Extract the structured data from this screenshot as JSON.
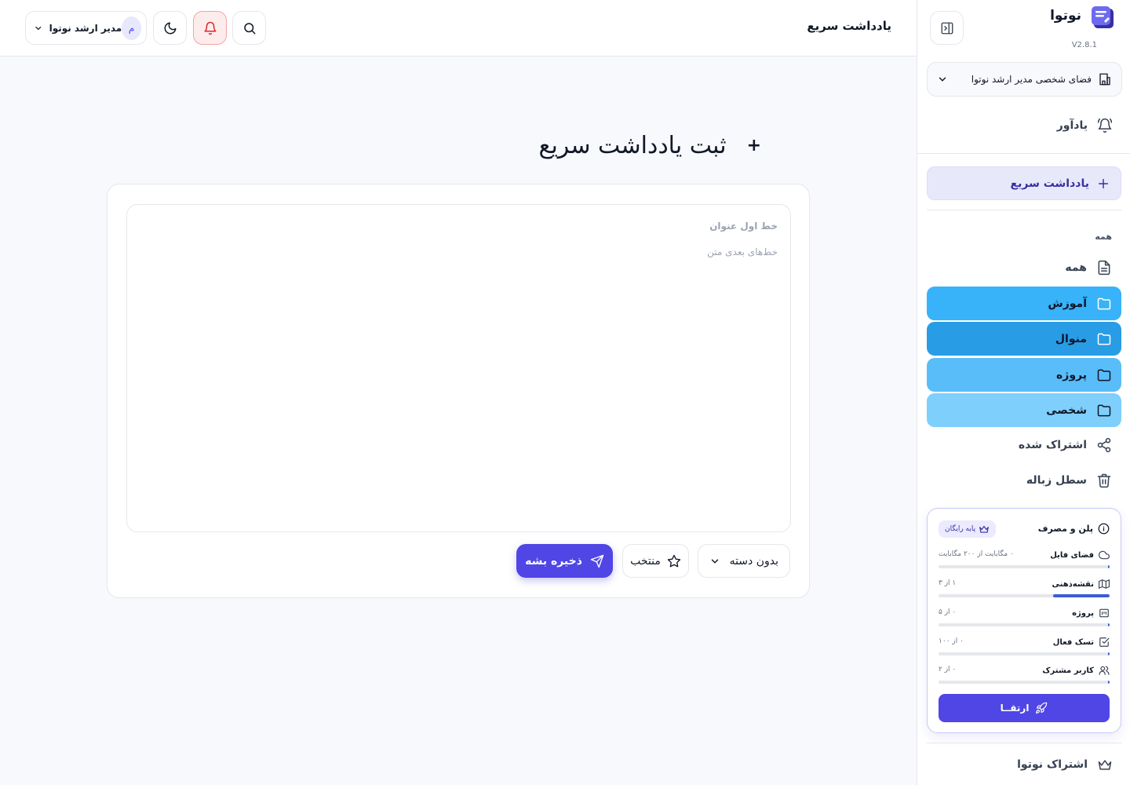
{
  "app": {
    "name": "نوتوا",
    "version": "V2.8.1"
  },
  "header": {
    "title": "یادداشت سریع",
    "user_name": "مدیر ارشد نوتوا",
    "avatar_initial": "م"
  },
  "sidebar": {
    "workspace": "فضای شخصی مدیر ارشد نوتوا",
    "reminder": "یادآور",
    "quick_note": "یادداشت سریع",
    "section_title": "همه",
    "nav_all": "همه",
    "folders": [
      {
        "label": "آموزش",
        "color": "#38b2f9"
      },
      {
        "label": "منوال",
        "color": "#299ce6"
      },
      {
        "label": "پروژه",
        "color": "#59bdf9"
      },
      {
        "label": "شخصی",
        "color": "#7ecffc"
      }
    ],
    "shared": "اشتراک شده",
    "trash": "سطل زباله",
    "subscription": "اشتراک نوتوا"
  },
  "plan": {
    "title": "پلن و مصرف",
    "badge": "پایه رایگان",
    "usages": [
      {
        "label": "فضای فایل",
        "value": "۰ مگابایت از ۲۰۰ مگابایت",
        "fraction": 0.0,
        "icon": "cloud-icon"
      },
      {
        "label": "نقشه‌ذهنی",
        "value": "۱ از ۳",
        "fraction": 0.33,
        "icon": "map-icon"
      },
      {
        "label": "پروژه",
        "value": "۰ از ۵",
        "fraction": 0.0,
        "icon": "project-icon"
      },
      {
        "label": "تسک فعال",
        "value": "۰ از ۱۰۰",
        "fraction": 0.0,
        "icon": "checkbox-icon"
      },
      {
        "label": "کاربر مشترک",
        "value": "۰ از ۲",
        "fraction": 0.0,
        "icon": "users-icon"
      }
    ],
    "upgrade": "ارتقــا"
  },
  "main": {
    "heading": "ثبت یادداشت سریع",
    "title_placeholder": "خط اول عنوان",
    "body_placeholder": "خط‌های بعدی متن",
    "category": "بدون دسته",
    "favorite": "منتخب",
    "save": "ذخیره بشه"
  },
  "colors": {
    "accent": "#4f46e5",
    "quick_note_bg": "#e8e8fb",
    "bell_bg": "#fdecec"
  }
}
